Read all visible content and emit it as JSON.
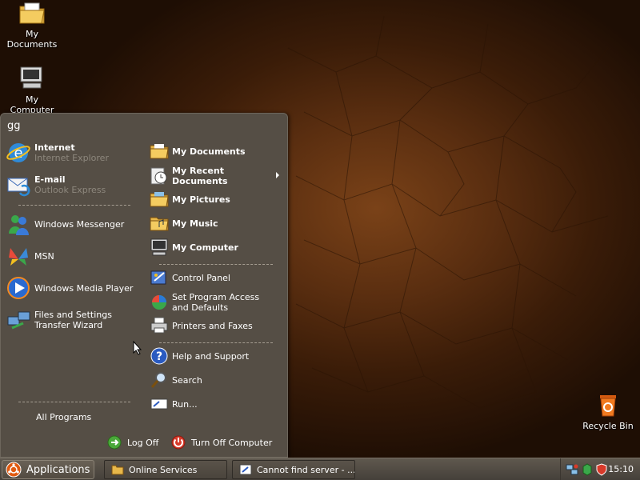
{
  "desktop": {
    "icons": [
      {
        "label": "My\nDocuments",
        "icon": "folder-documents-icon"
      },
      {
        "label": "My\nComputer",
        "icon": "computer-icon"
      },
      {
        "label": "Recycle Bin",
        "icon": "recycle-bin-icon"
      }
    ]
  },
  "start_menu": {
    "user": "gg",
    "pinned": [
      {
        "title": "Internet",
        "subtitle": "Internet Explorer",
        "icon": "internet-explorer-icon"
      },
      {
        "title": "E-mail",
        "subtitle": "Outlook Express",
        "icon": "outlook-express-icon"
      }
    ],
    "recent": [
      {
        "label": "Windows Messenger",
        "icon": "messenger-icon"
      },
      {
        "label": "MSN",
        "icon": "msn-butterfly-icon"
      },
      {
        "label": "Windows Media Player",
        "icon": "media-player-icon"
      },
      {
        "label": "Files and Settings\nTransfer Wizard",
        "icon": "transfer-wizard-icon"
      }
    ],
    "all_programs": "All Programs",
    "places": [
      {
        "label": "My Documents",
        "icon": "folder-documents-icon"
      },
      {
        "label": "My Recent\nDocuments",
        "icon": "recent-documents-icon"
      },
      {
        "label": "My Pictures",
        "icon": "folder-pictures-icon"
      },
      {
        "label": "My Music",
        "icon": "folder-music-icon"
      },
      {
        "label": "My Computer",
        "icon": "computer-icon"
      }
    ],
    "system": [
      {
        "label": "Control Panel",
        "icon": "control-panel-icon"
      },
      {
        "label": "Set Program Access\nand Defaults",
        "icon": "program-access-icon"
      },
      {
        "label": "Printers and Faxes",
        "icon": "printer-icon"
      }
    ],
    "help": [
      {
        "label": "Help and Support",
        "icon": "help-icon"
      },
      {
        "label": "Search",
        "icon": "search-icon"
      },
      {
        "label": "Run...",
        "icon": "run-icon"
      }
    ],
    "log_off": "Log Off",
    "turn_off": "Turn Off Computer"
  },
  "taskbar": {
    "start_label": "Applications",
    "tasks": [
      {
        "label": "Online Services",
        "icon": "folder-icon"
      },
      {
        "label": "Cannot find server - ...",
        "icon": "browser-window-icon"
      }
    ],
    "clock": "15:10"
  },
  "colors": {
    "menu_bg": "#554e45",
    "taskbar": "#4f493f",
    "wallpaper_center": "#7a4218"
  }
}
